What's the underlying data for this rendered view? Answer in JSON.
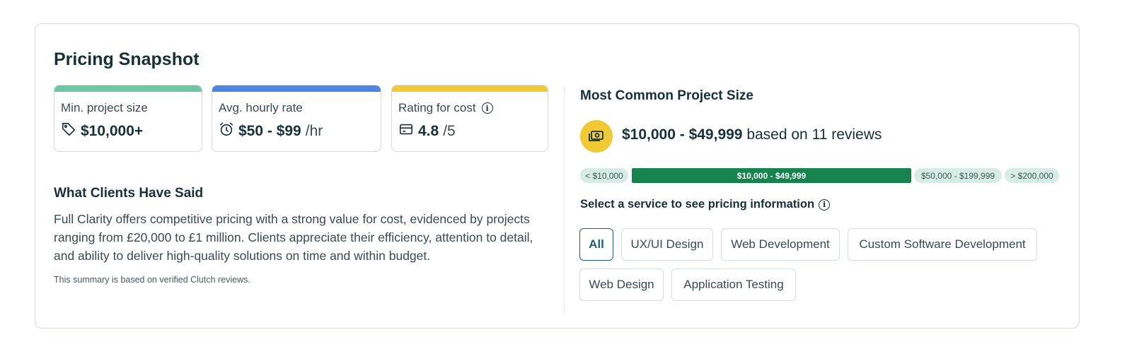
{
  "header": {
    "title": "Pricing Snapshot"
  },
  "stats": [
    {
      "label": "Min. project size",
      "value": "$10,000+",
      "unit": "",
      "icon": "price-tag-icon",
      "color": "#6cc7a3"
    },
    {
      "label": "Avg. hourly rate",
      "value": "$50 - $99",
      "unit": "/hr",
      "icon": "alarm-clock-icon",
      "color": "#4f87e0"
    },
    {
      "label": "Rating for cost",
      "value": "4.8",
      "unit": "/5",
      "icon": "credit-card-icon",
      "info_icon": "info-icon",
      "color": "#f1c932"
    }
  ],
  "clients": {
    "heading": "What Clients Have Said",
    "summary": "Full Clarity offers competitive pricing with a strong value for cost, evidenced by projects ranging from £20,000 to £1 million. Clients appreciate their efficiency, attention to detail, and ability to deliver high-quality solutions on time and within budget.",
    "footnote": "This summary is based on verified Clutch reviews."
  },
  "project_size": {
    "heading": "Most Common Project Size",
    "range": "$10,000 - $49,999",
    "suffix": "based on 11 reviews",
    "icon": "money-icon",
    "segments": [
      {
        "label": "< $10,000",
        "active": false
      },
      {
        "label": "$10,000 - $49,999",
        "active": true
      },
      {
        "label": "$50,000 - $199,999",
        "active": false
      },
      {
        "label": "> $200,000",
        "active": false
      }
    ]
  },
  "services": {
    "heading": "Select a service to see pricing information",
    "options": [
      "All",
      "UX/UI Design",
      "Web Development",
      "Custom Software Development",
      "Web Design",
      "Application Testing"
    ],
    "selected": "All"
  }
}
